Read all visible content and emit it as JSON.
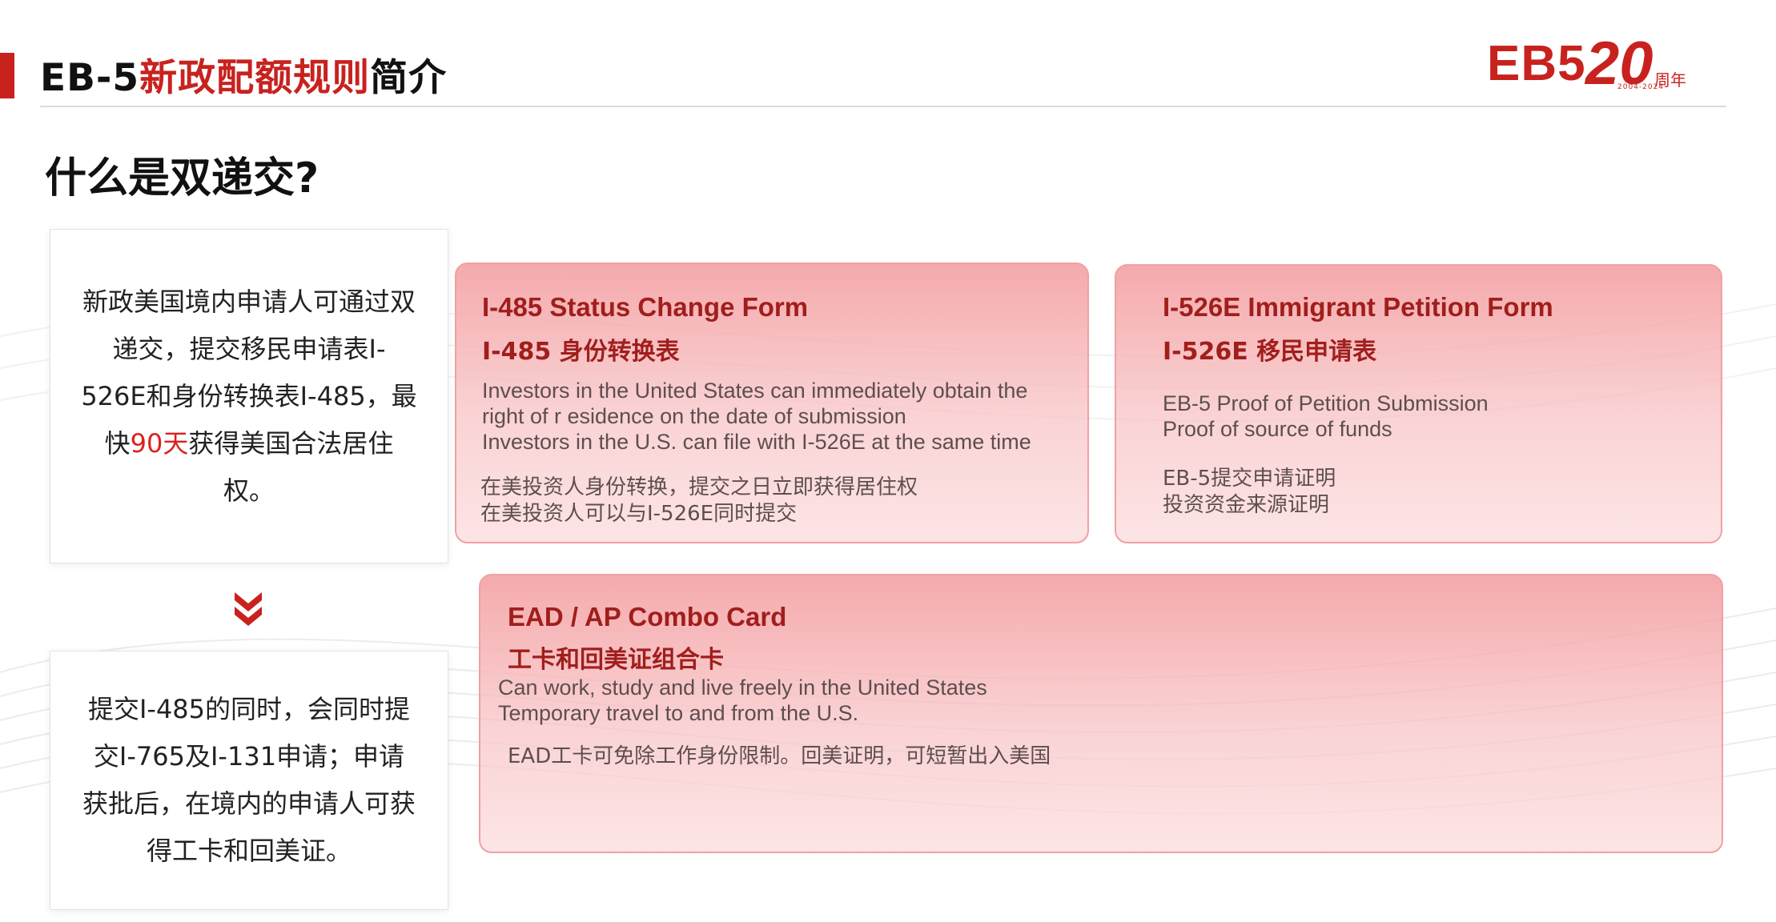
{
  "header": {
    "title_black_1": "EB-5",
    "title_red": "新政配额规则",
    "title_black_2": "简介"
  },
  "logo": {
    "eb5": "EB5",
    "twenty": "20",
    "years": "周年",
    "range": "2004-2024"
  },
  "question": "什么是双递交?",
  "left_boxes": {
    "top": {
      "before": "新政美国境内申请人可通过双递交，提交移民申请表I-526E和身份转换表I-485，最快",
      "highlight": "90天",
      "after": "获得美国合法居住权。"
    },
    "bottom": {
      "text": "提交I-485的同时，会同时提交I-765及I-131申请；申请获批后，在境内的申请人可获得工卡和回美证。"
    }
  },
  "cards": [
    {
      "title_en": "I-485 Status Change Form",
      "title_zh": "I-485 身份转换表",
      "lines_en": [
        "Investors in the United States can immediately obtain the",
        "right of r esidence on the date of submission",
        "Investors in the U.S. can file with I-526E at the same time"
      ],
      "lines_zh": [
        "在美投资人身份转换，提交之日立即获得居住权",
        "在美投资人可以与I-526E同时提交"
      ]
    },
    {
      "title_en": "I-526E Immigrant Petition Form",
      "title_zh": "I-526E 移民申请表",
      "lines_en": [
        "EB-5 Proof of Petition Submission",
        "Proof of source of funds"
      ],
      "lines_zh": [
        "EB-5提交申请证明",
        "投资资金来源证明"
      ]
    },
    {
      "title_en": "EAD / AP Combo Card",
      "title_zh": "工卡和回美证组合卡",
      "lines_en": [
        "Can work, study and live freely in the United States",
        "Temporary travel to and from the U.S."
      ],
      "lines_zh": [
        "EAD工卡可免除工作身份限制。回美证明，可短暂出入美国"
      ]
    }
  ],
  "colors": {
    "brand_red": "#c8221f",
    "highlight_red": "#d8231d",
    "card_title": "#a01e1c"
  }
}
